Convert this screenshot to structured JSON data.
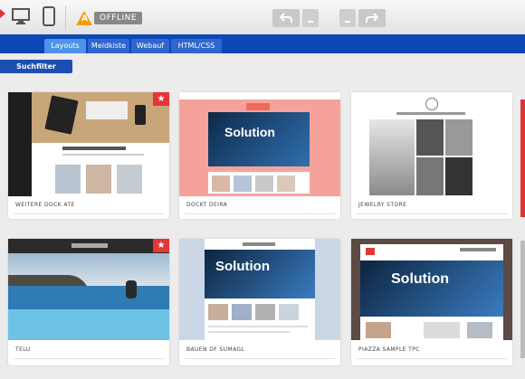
{
  "toolbar": {
    "offline_label": "OFFLINE",
    "badge_symbol": "A",
    "icons": [
      "desktop-icon",
      "tablet-icon",
      "undo-icon",
      "redo-icon"
    ]
  },
  "tabs": [
    {
      "label": "Layouts",
      "active": true
    },
    {
      "label": "Meldkiste",
      "active": false
    },
    {
      "label": "Webauf",
      "active": false
    },
    {
      "label": "HTML/CSS",
      "active": false
    }
  ],
  "filter_label": "Suchfilter",
  "templates": [
    {
      "name": "WEITERE DOCK ATE",
      "featured": true,
      "solution_text": ""
    },
    {
      "name": "DOCKT DEIRA",
      "featured": false,
      "solution_text": "Solution"
    },
    {
      "name": "JEWELRY STORE",
      "featured": false,
      "solution_text": ""
    },
    {
      "name": "TELU",
      "featured": true,
      "solution_text": ""
    },
    {
      "name": "BAUEN DF SUMAGL",
      "featured": false,
      "solution_text": "Solution"
    },
    {
      "name": "PIAZZA SAMPLE TPC",
      "featured": false,
      "solution_text": "Solution"
    }
  ],
  "colors": {
    "accent": "#0d48b7",
    "tab_active": "#4f93e8",
    "badge": "#f39c12",
    "featured": "#e53636"
  }
}
